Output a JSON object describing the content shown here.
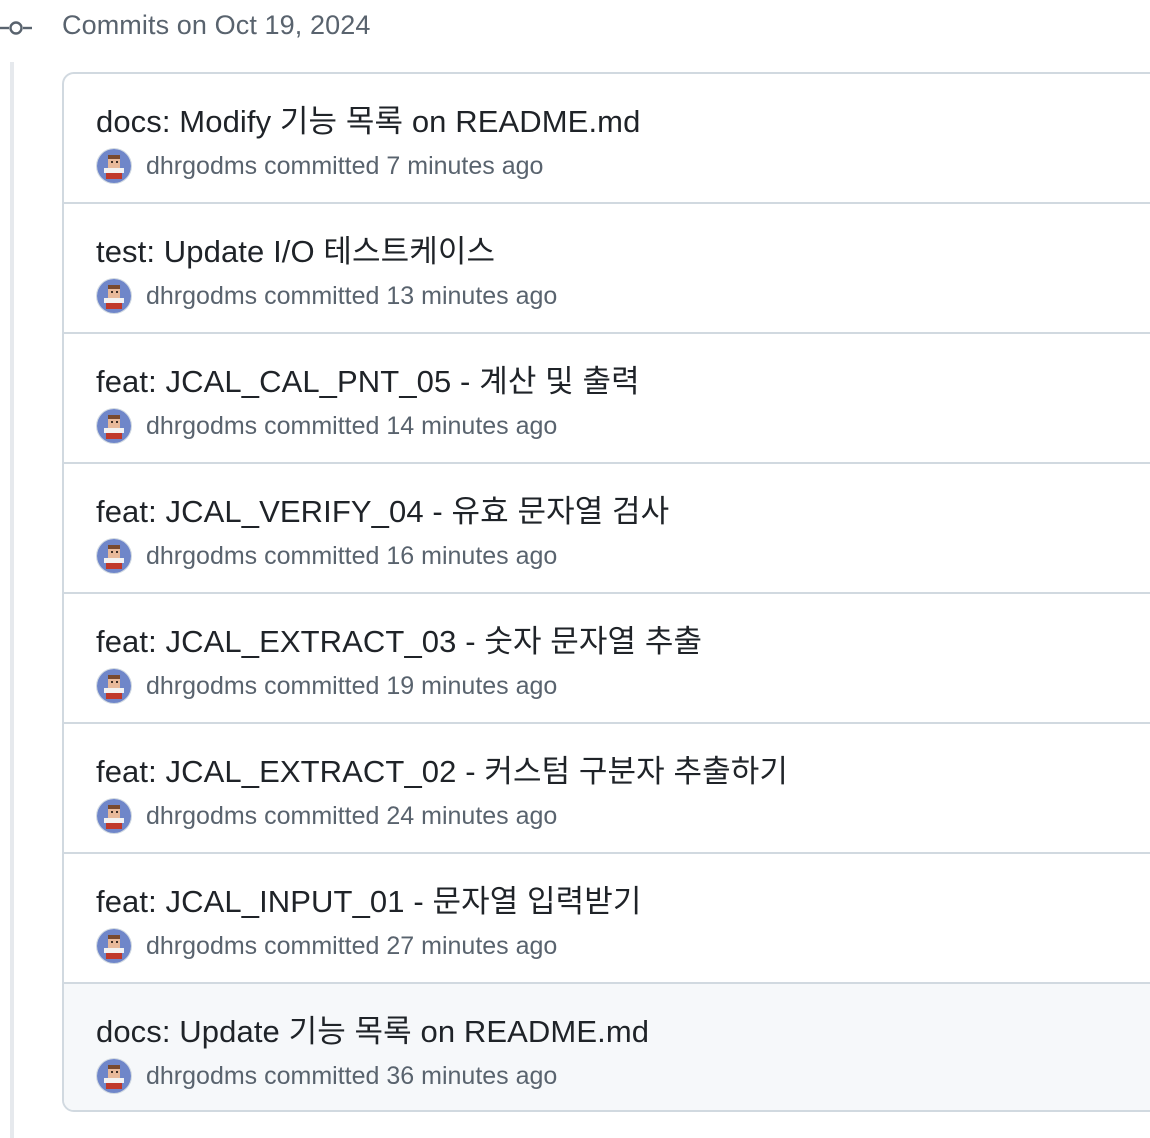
{
  "group": {
    "title": "Commits on Oct 19, 2024"
  },
  "colors": {
    "border": "#d1d9e0",
    "muted_text": "#59636e",
    "title_text": "#1f2328",
    "hover_row": "#f6f8fa",
    "timeline": "#e6e9ed"
  },
  "commits": [
    {
      "message": "docs: Modify 기능 목록 on README.md",
      "author": "dhrgodms",
      "action": "committed",
      "time": "7 minutes ago"
    },
    {
      "message": "test: Update I/O 테스트케이스",
      "author": "dhrgodms",
      "action": "committed",
      "time": "13 minutes ago"
    },
    {
      "message": "feat: JCAL_CAL_PNT_05 - 계산 및 출력",
      "author": "dhrgodms",
      "action": "committed",
      "time": "14 minutes ago"
    },
    {
      "message": "feat: JCAL_VERIFY_04 - 유효 문자열 검사",
      "author": "dhrgodms",
      "action": "committed",
      "time": "16 minutes ago"
    },
    {
      "message": "feat: JCAL_EXTRACT_03 - 숫자 문자열 추출",
      "author": "dhrgodms",
      "action": "committed",
      "time": "19 minutes ago"
    },
    {
      "message": "feat: JCAL_EXTRACT_02 - 커스텀 구분자 추출하기",
      "author": "dhrgodms",
      "action": "committed",
      "time": "24 minutes ago"
    },
    {
      "message": "feat: JCAL_INPUT_01 - 문자열 입력받기",
      "author": "dhrgodms",
      "action": "committed",
      "time": "27 minutes ago"
    },
    {
      "message": "docs: Update 기능 목록 on README.md",
      "author": "dhrgodms",
      "action": "committed",
      "time": "36 minutes ago"
    }
  ]
}
